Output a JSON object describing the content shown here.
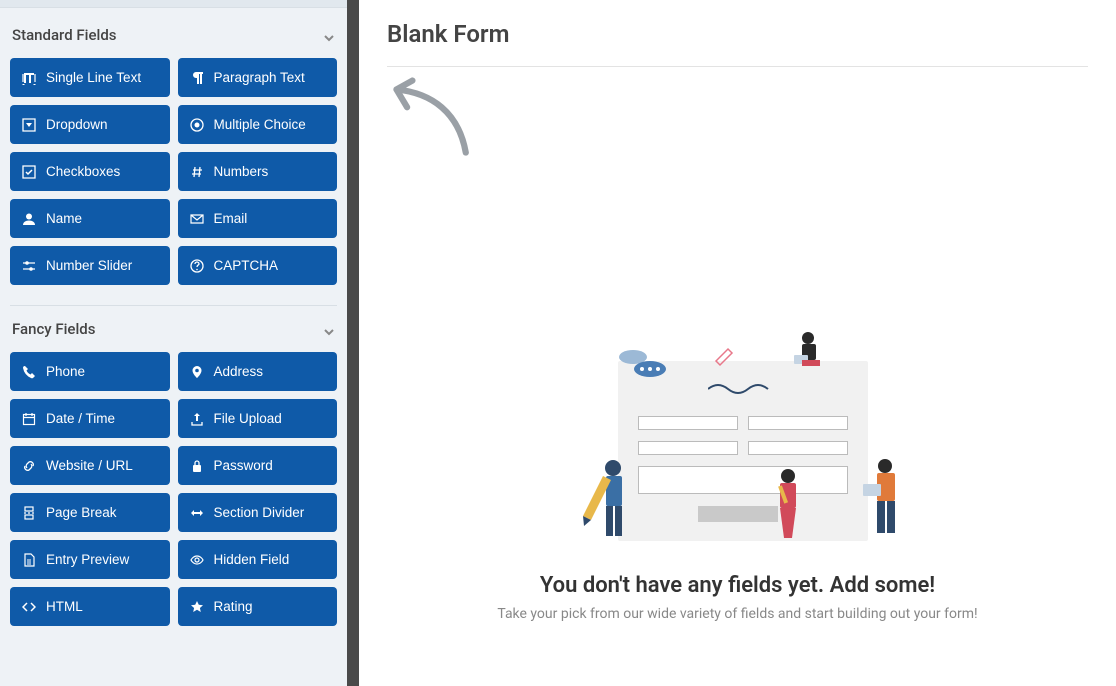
{
  "form": {
    "title": "Blank Form"
  },
  "sections": {
    "standard": {
      "title": "Standard Fields"
    },
    "fancy": {
      "title": "Fancy Fields"
    }
  },
  "standard_fields": [
    {
      "label": "Single Line Text",
      "icon": "text-height-icon"
    },
    {
      "label": "Paragraph Text",
      "icon": "paragraph-icon"
    },
    {
      "label": "Dropdown",
      "icon": "caret-square-icon"
    },
    {
      "label": "Multiple Choice",
      "icon": "dot-circle-icon"
    },
    {
      "label": "Checkboxes",
      "icon": "check-square-icon"
    },
    {
      "label": "Numbers",
      "icon": "hash-icon"
    },
    {
      "label": "Name",
      "icon": "user-icon"
    },
    {
      "label": "Email",
      "icon": "envelope-icon"
    },
    {
      "label": "Number Slider",
      "icon": "sliders-icon"
    },
    {
      "label": "CAPTCHA",
      "icon": "question-circle-icon"
    }
  ],
  "fancy_fields": [
    {
      "label": "Phone",
      "icon": "phone-icon"
    },
    {
      "label": "Address",
      "icon": "map-pin-icon"
    },
    {
      "label": "Date / Time",
      "icon": "calendar-icon"
    },
    {
      "label": "File Upload",
      "icon": "upload-icon"
    },
    {
      "label": "Website / URL",
      "icon": "link-icon"
    },
    {
      "label": "Password",
      "icon": "lock-icon"
    },
    {
      "label": "Page Break",
      "icon": "page-break-icon"
    },
    {
      "label": "Section Divider",
      "icon": "arrows-h-icon"
    },
    {
      "label": "Entry Preview",
      "icon": "file-icon"
    },
    {
      "label": "Hidden Field",
      "icon": "eye-slash-icon"
    },
    {
      "label": "HTML",
      "icon": "code-icon"
    },
    {
      "label": "Rating",
      "icon": "star-icon"
    }
  ],
  "empty_state": {
    "heading": "You don't have any fields yet. Add some!",
    "sub": "Take your pick from our wide variety of fields and start building out your form!"
  },
  "colors": {
    "primary": "#0f5aa8",
    "sidebar_bg": "#eef2f6"
  }
}
